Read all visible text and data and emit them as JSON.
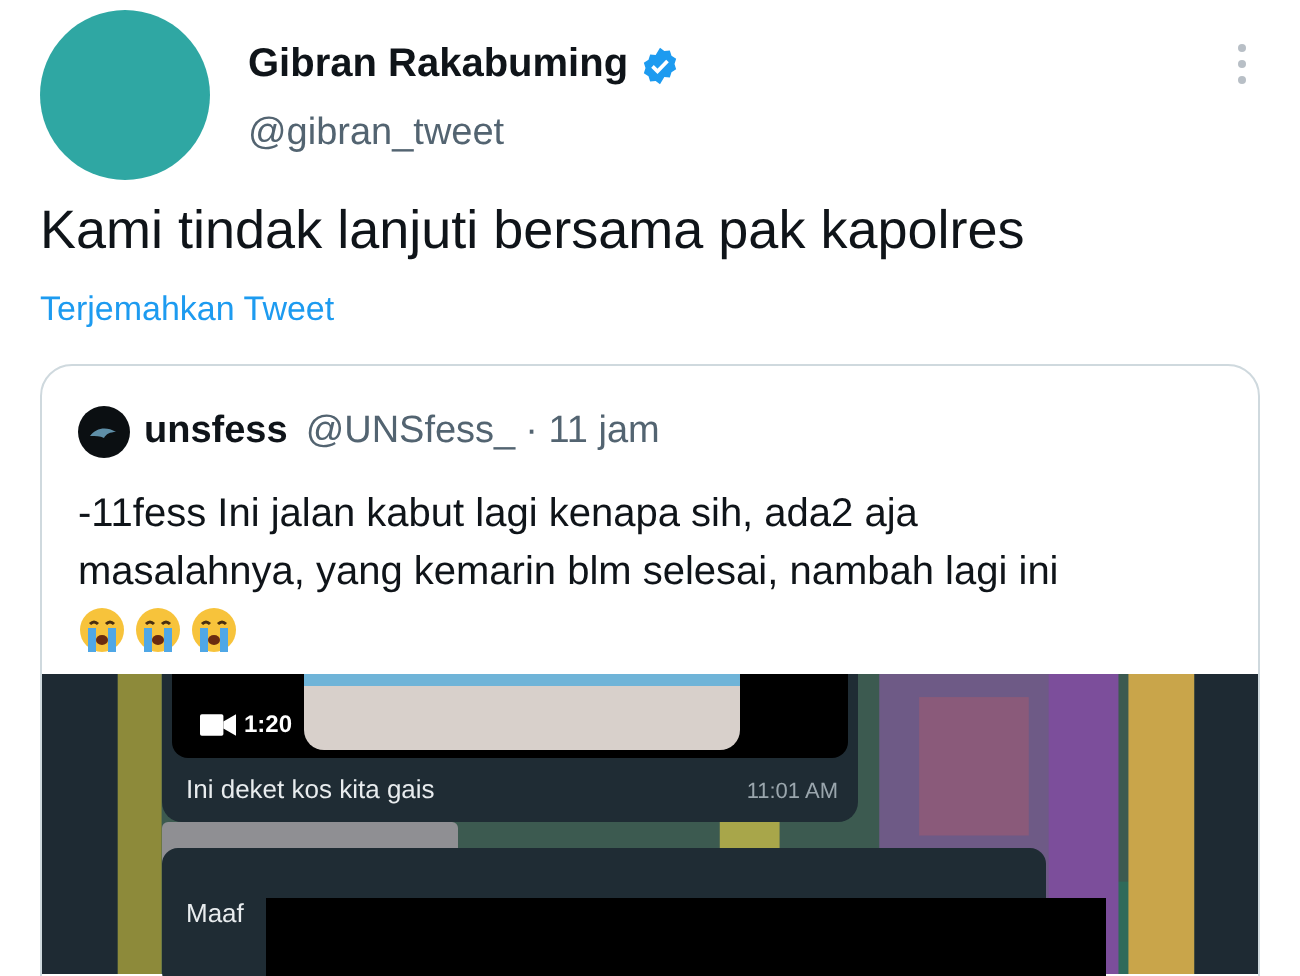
{
  "tweet": {
    "author": {
      "name": "Gibran Rakabuming",
      "handle": "@gibran_tweet",
      "verified": true
    },
    "text": "Kami tindak lanjuti bersama pak kapolres",
    "translate_link": "Terjemahkan Tweet",
    "quote": {
      "author": {
        "name": "unsfess",
        "handle": "@UNSfess_",
        "time": "· 11 jam"
      },
      "text": "-11fess Ini jalan kabut lagi kenapa sih, ada2 aja masalahnya, yang kemarin blm selesai, nambah lagi ini",
      "emojis": [
        {
          "kind": "crying"
        },
        {
          "kind": "crying"
        },
        {
          "kind": "crying"
        }
      ],
      "media": {
        "kind": "picture",
        "video_duration": "1:20",
        "caption": "Ini deket kos kita gais",
        "caption_time": "11:01 AM",
        "next_message": "Maaf"
      }
    }
  }
}
